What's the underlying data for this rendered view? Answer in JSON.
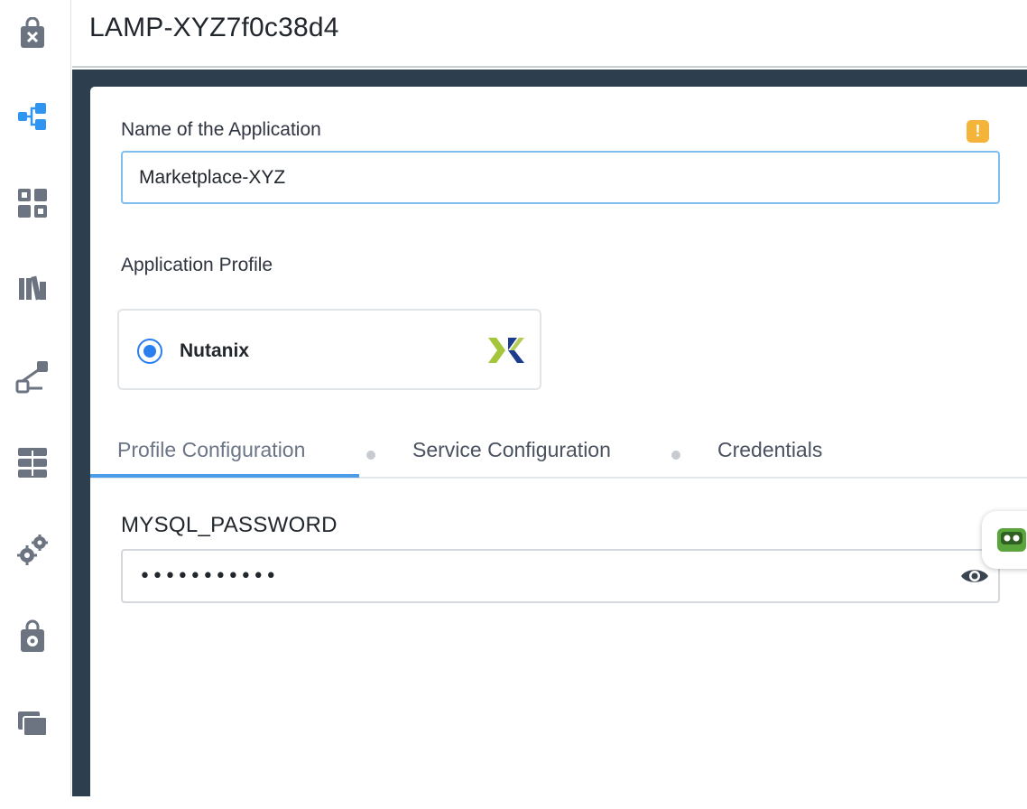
{
  "header": {
    "title": "LAMP-XYZ7f0c38d4"
  },
  "sidebar": {
    "items": [
      {
        "icon": "marketplace-bag-icon"
      },
      {
        "icon": "blueprint-tree-icon",
        "active": true
      },
      {
        "icon": "applications-grid-icon"
      },
      {
        "icon": "library-books-icon"
      },
      {
        "icon": "runbooks-flow-icon"
      },
      {
        "icon": "endpoints-server-icon"
      },
      {
        "icon": "settings-gears-icon"
      },
      {
        "icon": "marketplace-manager-bag-icon"
      },
      {
        "icon": "projects-folder-icon"
      }
    ]
  },
  "form": {
    "name_label": "Name of the Application",
    "name_value": "Marketplace-XYZ",
    "warning_symbol": "!",
    "profile_label": "Application Profile",
    "profile_option": {
      "name": "Nutanix",
      "selected": true,
      "logo": "nutanix-logo"
    }
  },
  "tabs": [
    {
      "label": "Profile Configuration",
      "active": true
    },
    {
      "label": "Service Configuration",
      "active": false
    },
    {
      "label": "Credentials",
      "active": false
    }
  ],
  "credentials": {
    "field_title": "MYSQL_PASSWORD",
    "password_mask": "•••••••••••"
  },
  "colors": {
    "accent": "#2a7ef0",
    "active_nav": "#2f95f0",
    "dark_frame": "#2d3e4e",
    "warning": "#f4b43a",
    "nutanix_green": "#a5c63b",
    "nutanix_blue": "#1b3c8c"
  }
}
